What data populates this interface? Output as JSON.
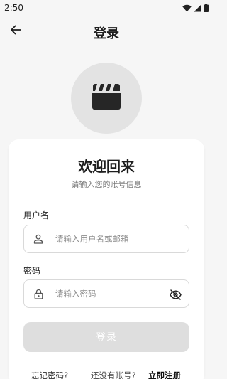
{
  "status_bar": {
    "time": "2:50",
    "icons": [
      "wifi-icon",
      "cellular-icon",
      "battery-icon"
    ]
  },
  "app_bar": {
    "back_icon": "arrow-left-icon",
    "title": "登录"
  },
  "logo": {
    "icon": "clapperboard-icon"
  },
  "card": {
    "title": "欢迎回来",
    "subtitle": "请输入您的账号信息",
    "username": {
      "label": "用户名",
      "icon": "person-icon",
      "placeholder": "请输入用户名或邮箱",
      "value": ""
    },
    "password": {
      "label": "密码",
      "icon": "lock-icon",
      "placeholder": "请输入密码",
      "value": "",
      "visibility_icon": "eye-off-icon"
    },
    "login_button": "登录",
    "forgot_password": "忘记密码?",
    "no_account": "还没有账号?",
    "register": "立即注册"
  },
  "colors": {
    "background": "#f6f6f6",
    "card": "#ffffff",
    "logo_circle": "#e3e3e3",
    "button_disabled": "#dedede",
    "input_border": "#d9d9d9"
  }
}
